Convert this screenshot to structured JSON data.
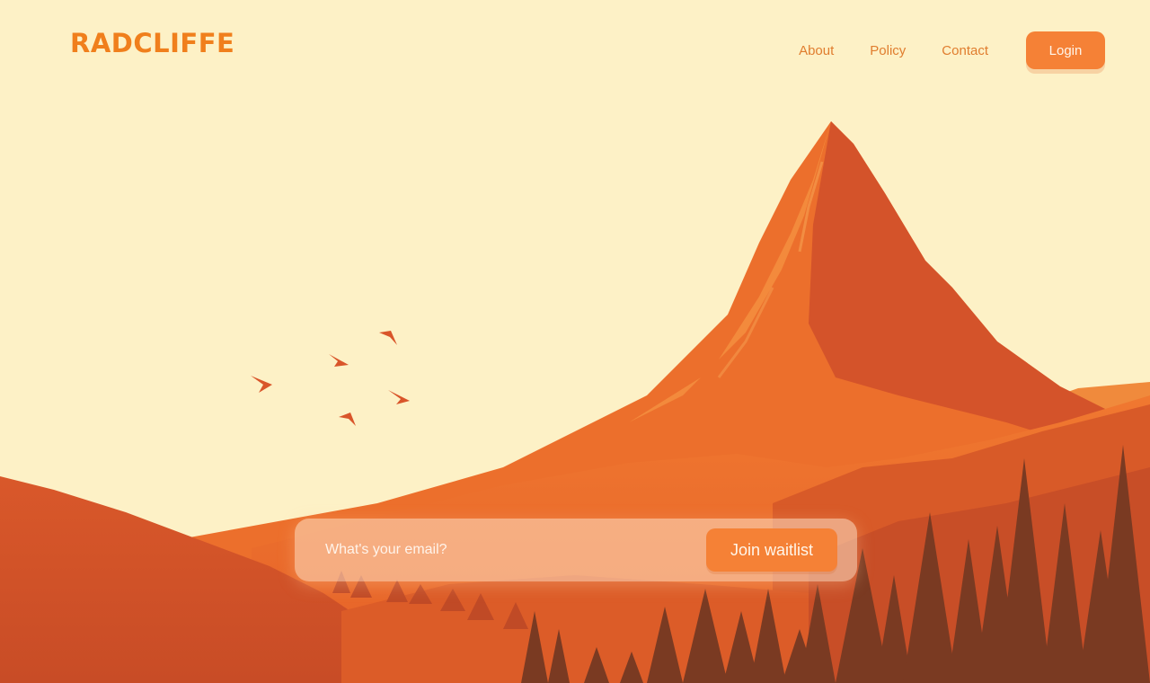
{
  "brand": {
    "logo_text": "RADCLIFFE"
  },
  "nav": {
    "links": [
      "About",
      "Policy",
      "Contact"
    ],
    "login_label": "Login"
  },
  "waitlist": {
    "email_placeholder": "What's your email?",
    "join_label": "Join waitlist"
  },
  "colors": {
    "background": "#fdf1c6",
    "accent": "#f58136",
    "mountain": "#e2622a",
    "forest": "#7a3a22"
  }
}
